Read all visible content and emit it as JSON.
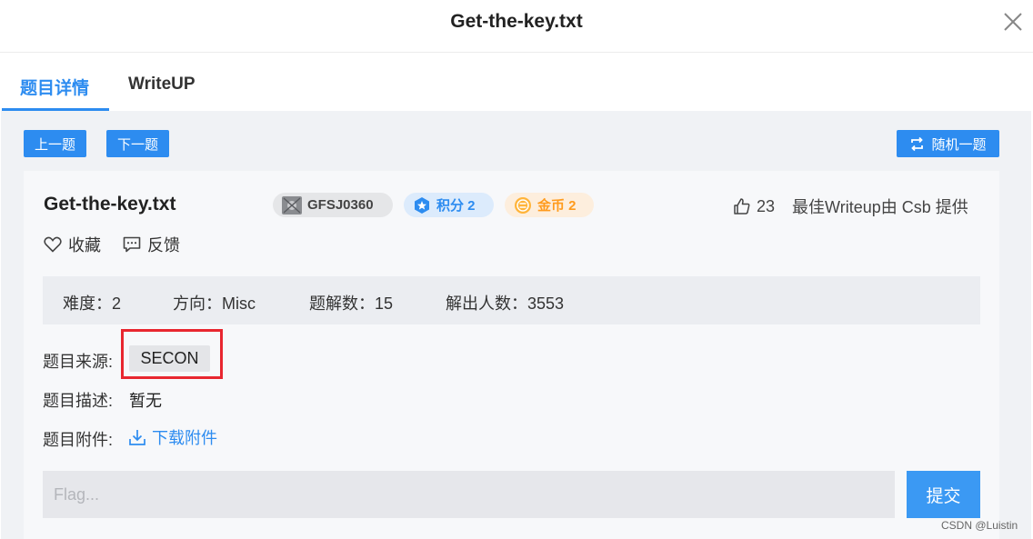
{
  "modal": {
    "title": "Get-the-key.txt",
    "close_icon": "close-icon"
  },
  "tabs": [
    {
      "label": "题目详情",
      "active": true
    },
    {
      "label": "WriteUP",
      "active": false
    }
  ],
  "nav": {
    "prev_label": "上一题",
    "next_label": "下一题",
    "random_label": "随机一题",
    "random_icon": "shuffle-icon"
  },
  "challenge": {
    "title": "Get-the-key.txt",
    "badges": {
      "id": "GFSJ0360",
      "score": "积分 2",
      "coin": "金币 2"
    },
    "likes": "23",
    "best_writeup": "最佳Writeup由 Csb 提供",
    "favorite_label": "收藏",
    "feedback_label": "反馈",
    "stats": {
      "difficulty": "难度：2",
      "direction": "方向：Misc",
      "solves": "题解数：15",
      "solvers": "解出人数：3553"
    },
    "source_label": "题目来源:",
    "source_value": "SECON",
    "desc_label": "题目描述:",
    "desc_value": "暂无",
    "attach_label": "题目附件:",
    "download_label": "下载附件"
  },
  "flag": {
    "placeholder": "Flag...",
    "value": "",
    "submit_label": "提交"
  },
  "watermark": "CSDN @Luistin",
  "colors": {
    "accent": "#2d8cf0",
    "highlight": "#e8262f",
    "coin": "#ff9b1d"
  }
}
